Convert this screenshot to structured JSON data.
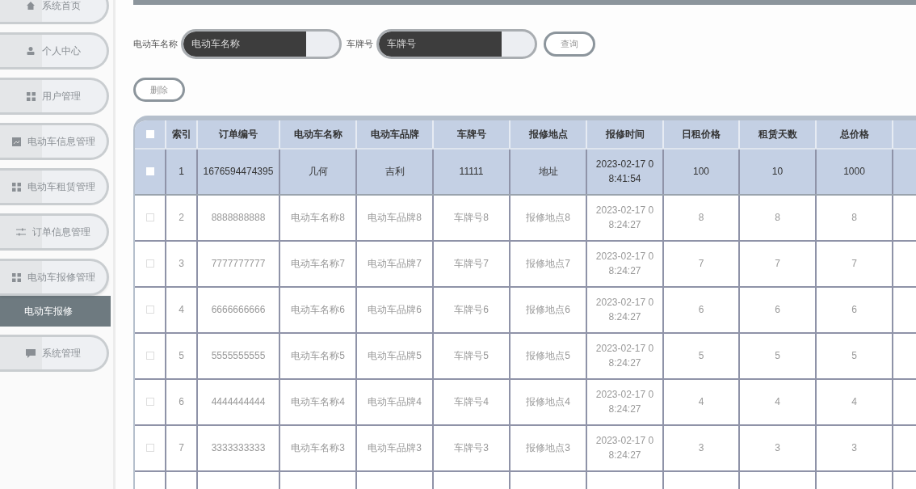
{
  "sidebar": {
    "items": [
      {
        "label": "系统首页",
        "expanded": false
      },
      {
        "label": "个人中心",
        "expanded": false
      },
      {
        "label": "用户管理",
        "expanded": false
      },
      {
        "label": "电动车信息管理",
        "expanded": false
      },
      {
        "label": "电动车租赁管理",
        "expanded": false
      },
      {
        "label": "订单信息管理",
        "expanded": false
      },
      {
        "label": "电动车报修管理",
        "expanded": true,
        "children": [
          {
            "label": "电动车报修",
            "selected": true
          }
        ]
      },
      {
        "label": "系统管理",
        "expanded": false
      }
    ]
  },
  "search": {
    "fields": [
      {
        "label": "电动车名称",
        "placeholder": "电动车名称"
      },
      {
        "label": "车牌号",
        "placeholder": "车牌号"
      }
    ],
    "query_button": "查询"
  },
  "delete_button": "删除",
  "table": {
    "all_checked": false,
    "columns": [
      "索引",
      "订单编号",
      "电动车名称",
      "电动车品牌",
      "车牌号",
      "报修地点",
      "报修时间",
      "日租价格",
      "租赁天数",
      "总价格"
    ],
    "rows": [
      {
        "selected": true,
        "cells": [
          "1",
          "1676594474395",
          "几何",
          "吉利",
          "11111",
          "地址",
          "2023-02-17 0\n8:41:54",
          "100",
          "10",
          "1000"
        ]
      },
      {
        "selected": false,
        "cells": [
          "2",
          "8888888888",
          "电动车名称8",
          "电动车品牌8",
          "车牌号8",
          "报修地点8",
          "2023-02-17 0\n8:24:27",
          "8",
          "8",
          "8"
        ]
      },
      {
        "selected": false,
        "cells": [
          "3",
          "7777777777",
          "电动车名称7",
          "电动车品牌7",
          "车牌号7",
          "报修地点7",
          "2023-02-17 0\n8:24:27",
          "7",
          "7",
          "7"
        ]
      },
      {
        "selected": false,
        "cells": [
          "4",
          "6666666666",
          "电动车名称6",
          "电动车品牌6",
          "车牌号6",
          "报修地点6",
          "2023-02-17 0\n8:24:27",
          "6",
          "6",
          "6"
        ]
      },
      {
        "selected": false,
        "cells": [
          "5",
          "5555555555",
          "电动车名称5",
          "电动车品牌5",
          "车牌号5",
          "报修地点5",
          "2023-02-17 0\n8:24:27",
          "5",
          "5",
          "5"
        ]
      },
      {
        "selected": false,
        "cells": [
          "6",
          "4444444444",
          "电动车名称4",
          "电动车品牌4",
          "车牌号4",
          "报修地点4",
          "2023-02-17 0\n8:24:27",
          "4",
          "4",
          "4"
        ]
      },
      {
        "selected": false,
        "cells": [
          "7",
          "3333333333",
          "电动车名称3",
          "电动车品牌3",
          "车牌号3",
          "报修地点3",
          "2023-02-17 0\n8:24:27",
          "3",
          "3",
          "3"
        ]
      }
    ]
  }
}
